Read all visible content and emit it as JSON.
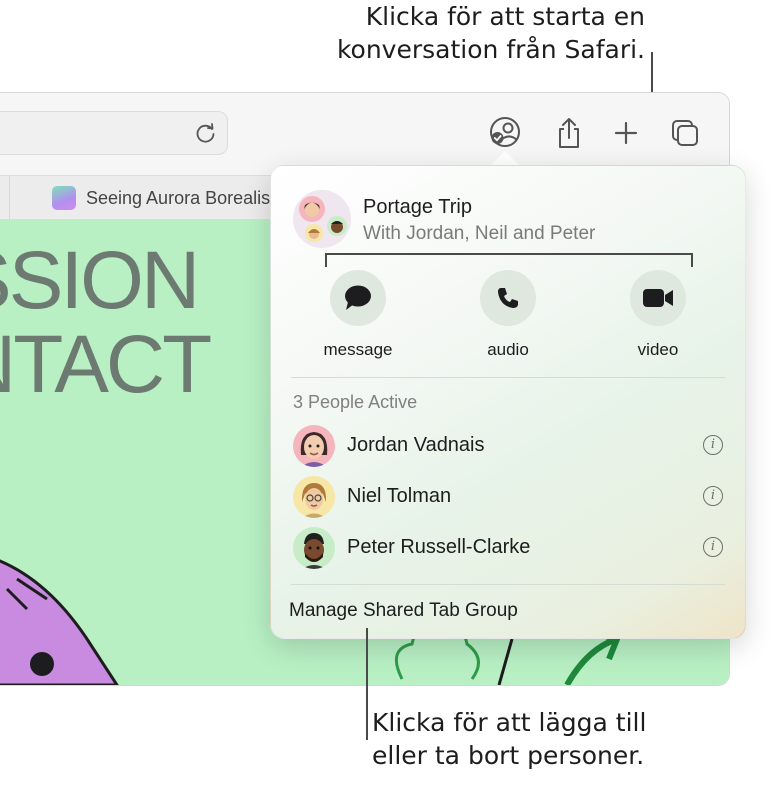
{
  "callouts": {
    "top_line1": "Klicka för att starta en",
    "top_line2": "konversation från Safari.",
    "bottom_line1": "Klicka för att lägga till",
    "bottom_line2": "eller ta bort personer."
  },
  "browser": {
    "tab_title": "Seeing Aurora Borealis",
    "hero_line1": "SSION",
    "hero_line2": "NTACT"
  },
  "toolbar_icons": [
    "reload-icon",
    "shared-tab-group-icon",
    "share-icon",
    "new-tab-icon",
    "tab-overview-icon"
  ],
  "popover": {
    "group_name": "Portage Trip",
    "group_members": "With Jordan, Neil and Peter",
    "actions": [
      {
        "label": "message",
        "icon": "speech-bubble-icon"
      },
      {
        "label": "audio",
        "icon": "phone-icon"
      },
      {
        "label": "video",
        "icon": "video-camera-icon"
      }
    ],
    "active_header": "3 People Active",
    "people": [
      {
        "name": "Jordan Vadnais",
        "bg": "#f4b6bc"
      },
      {
        "name": "Niel Tolman",
        "bg": "#f7e7a6"
      },
      {
        "name": "Peter Russell-Clarke",
        "bg": "#c8ecc8"
      }
    ],
    "manage_label": "Manage Shared Tab Group"
  },
  "colors": {
    "page_background": "#b8f0c4",
    "action_circle": "#dfe8df"
  }
}
